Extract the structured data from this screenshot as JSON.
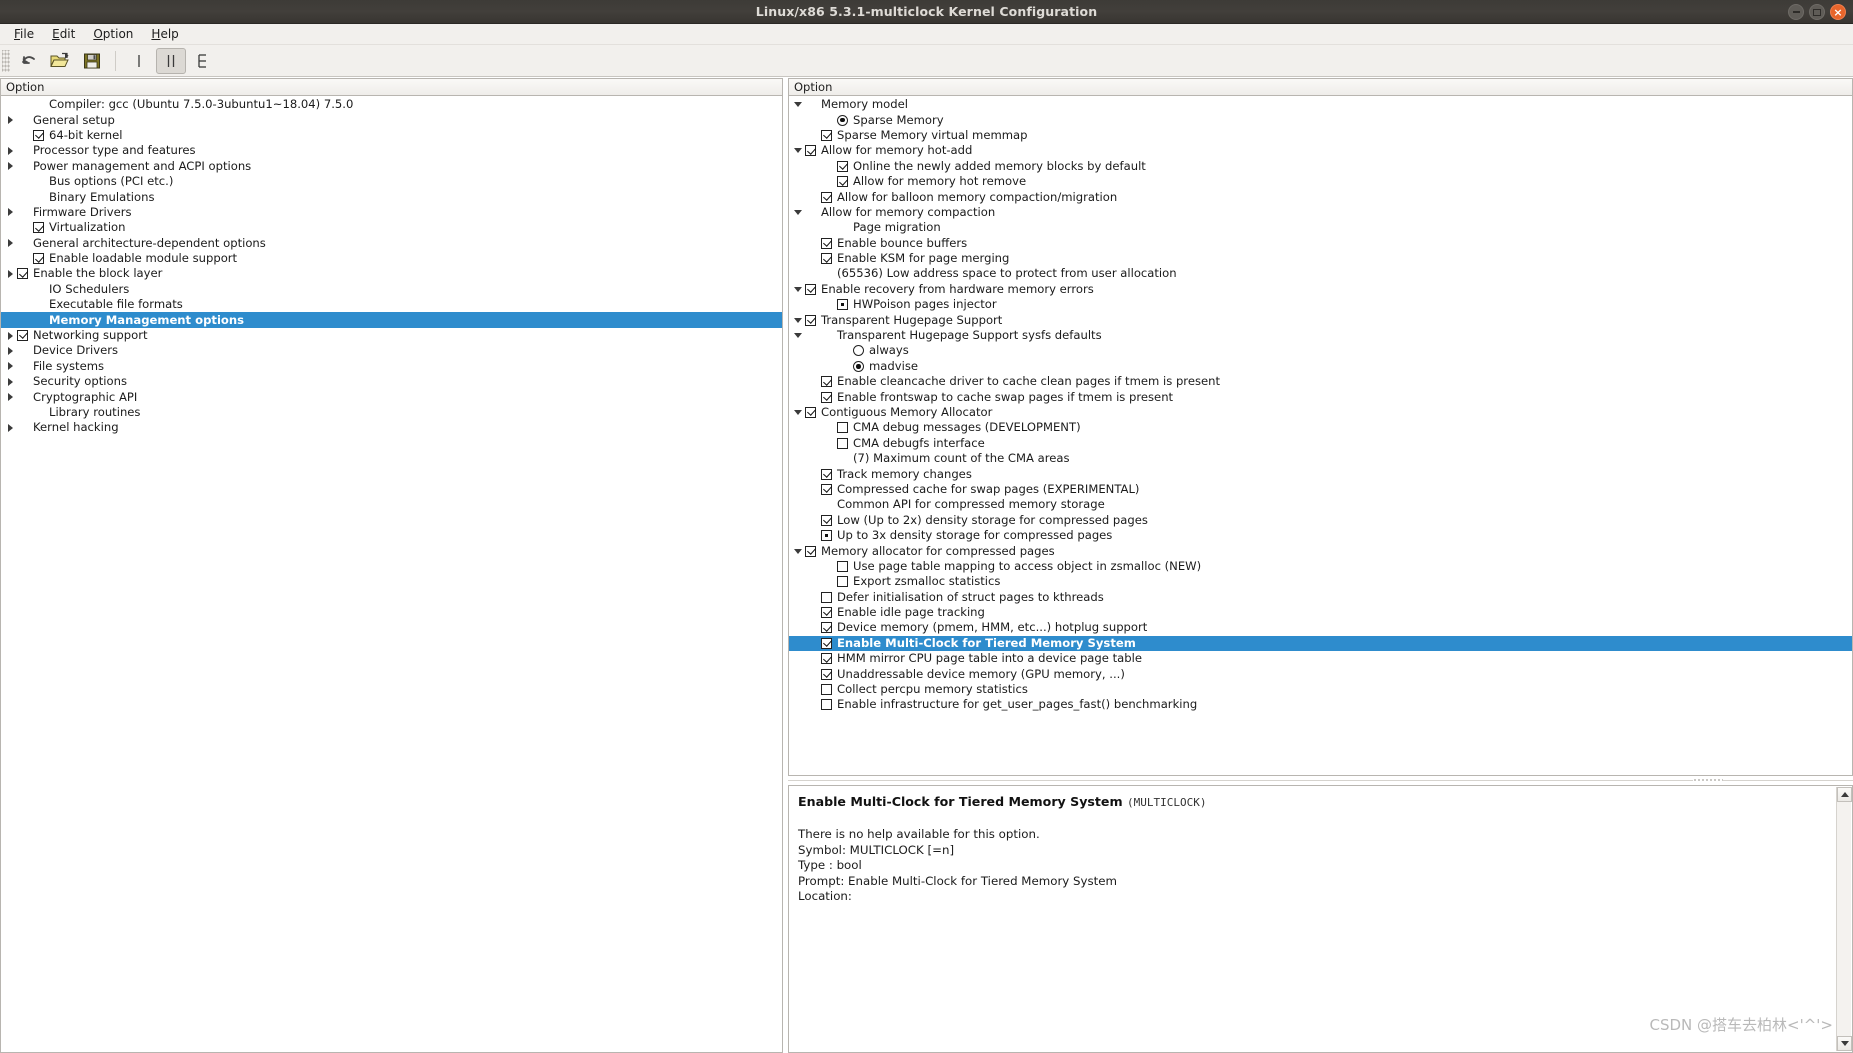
{
  "window": {
    "title": "Linux/x86 5.3.1-multiclock Kernel Configuration",
    "controls": {
      "minimize": "−",
      "maximize": "□",
      "close": "×"
    },
    "accent_selection": "#2e8ccd",
    "titlebar_color": "#403d39",
    "close_color": "#e8652b"
  },
  "menubar": [
    {
      "label": "File",
      "mnemonic": "F"
    },
    {
      "label": "Edit",
      "mnemonic": "E"
    },
    {
      "label": "Option",
      "mnemonic": "O"
    },
    {
      "label": "Help",
      "mnemonic": "H"
    }
  ],
  "toolbar": [
    {
      "name": "back-button",
      "icon": "undo-arrow-icon",
      "active": false
    },
    {
      "name": "load-button",
      "icon": "open-folder-icon",
      "active": false
    },
    {
      "name": "save-button",
      "icon": "floppy-save-icon",
      "active": false
    },
    {
      "name": "single-view-button",
      "icon": "single-pane-icon",
      "active": false
    },
    {
      "name": "split-view-button",
      "icon": "split-pane-icon",
      "active": true
    },
    {
      "name": "full-view-button",
      "icon": "tree-view-icon",
      "active": false
    }
  ],
  "left_panel": {
    "header": "Option",
    "rows": [
      {
        "indent": 1,
        "arrow": "none",
        "box": "none",
        "label": "Compiler: gcc (Ubuntu 7.5.0-3ubuntu1~18.04) 7.5.0"
      },
      {
        "indent": 0,
        "arrow": "right",
        "box": "none",
        "label": "General setup"
      },
      {
        "indent": 1,
        "arrow": "none",
        "box": "checked",
        "label": "64-bit kernel"
      },
      {
        "indent": 0,
        "arrow": "right",
        "box": "none",
        "label": "Processor type and features"
      },
      {
        "indent": 0,
        "arrow": "right",
        "box": "none",
        "label": "Power management and ACPI options"
      },
      {
        "indent": 1,
        "arrow": "none",
        "box": "none",
        "label": "Bus options (PCI etc.)"
      },
      {
        "indent": 1,
        "arrow": "none",
        "box": "none",
        "label": "Binary Emulations"
      },
      {
        "indent": 0,
        "arrow": "right",
        "box": "none",
        "label": "Firmware Drivers"
      },
      {
        "indent": 1,
        "arrow": "none",
        "box": "checked",
        "label": "Virtualization"
      },
      {
        "indent": 0,
        "arrow": "right",
        "box": "none",
        "label": "General architecture-dependent options"
      },
      {
        "indent": 1,
        "arrow": "none",
        "box": "checked",
        "label": "Enable loadable module support"
      },
      {
        "indent": 0,
        "arrow": "right",
        "box": "checked",
        "label": "Enable the block layer"
      },
      {
        "indent": 1,
        "arrow": "none",
        "box": "none",
        "label": "IO Schedulers"
      },
      {
        "indent": 1,
        "arrow": "none",
        "box": "none",
        "label": "Executable file formats"
      },
      {
        "indent": 1,
        "arrow": "none",
        "box": "none",
        "label": "Memory Management options",
        "selected": true
      },
      {
        "indent": 0,
        "arrow": "right",
        "box": "checked",
        "label": "Networking support"
      },
      {
        "indent": 0,
        "arrow": "right",
        "box": "none",
        "label": "Device Drivers"
      },
      {
        "indent": 0,
        "arrow": "right",
        "box": "none",
        "label": "File systems"
      },
      {
        "indent": 0,
        "arrow": "right",
        "box": "none",
        "label": "Security options"
      },
      {
        "indent": 0,
        "arrow": "right",
        "box": "none",
        "label": "Cryptographic API"
      },
      {
        "indent": 1,
        "arrow": "none",
        "box": "none",
        "label": "Library routines"
      },
      {
        "indent": 0,
        "arrow": "right",
        "box": "none",
        "label": "Kernel hacking"
      }
    ]
  },
  "right_panel": {
    "header": "Option",
    "rows": [
      {
        "indent": 0,
        "arrow": "down",
        "box": "none",
        "label": "Memory model"
      },
      {
        "indent": 2,
        "arrow": "none",
        "box": "radio-on",
        "label": "Sparse Memory"
      },
      {
        "indent": 1,
        "arrow": "none",
        "box": "checked",
        "label": "Sparse Memory virtual memmap"
      },
      {
        "indent": 0,
        "arrow": "down",
        "box": "checked",
        "label": "Allow for memory hot-add"
      },
      {
        "indent": 2,
        "arrow": "none",
        "box": "checked",
        "label": "Online the newly added memory blocks by default"
      },
      {
        "indent": 2,
        "arrow": "none",
        "box": "checked",
        "label": "Allow for memory hot remove"
      },
      {
        "indent": 1,
        "arrow": "none",
        "box": "checked",
        "label": "Allow for balloon memory compaction/migration"
      },
      {
        "indent": 0,
        "arrow": "down",
        "box": "none",
        "label": "Allow for memory compaction"
      },
      {
        "indent": 2,
        "arrow": "none",
        "box": "none",
        "label": "Page migration"
      },
      {
        "indent": 1,
        "arrow": "none",
        "box": "checked",
        "label": "Enable bounce buffers"
      },
      {
        "indent": 1,
        "arrow": "none",
        "box": "checked",
        "label": "Enable KSM for page merging"
      },
      {
        "indent": 1,
        "arrow": "none",
        "box": "none",
        "label": "(65536) Low address space to protect from user allocation"
      },
      {
        "indent": 0,
        "arrow": "down",
        "box": "checked",
        "label": "Enable recovery from hardware memory errors"
      },
      {
        "indent": 2,
        "arrow": "none",
        "box": "module",
        "label": "HWPoison pages injector"
      },
      {
        "indent": 0,
        "arrow": "down",
        "box": "checked",
        "label": "Transparent Hugepage Support"
      },
      {
        "indent": 1,
        "arrow": "down",
        "box": "none",
        "label": "Transparent Hugepage Support sysfs defaults"
      },
      {
        "indent": 3,
        "arrow": "none",
        "box": "radio-off",
        "label": "always"
      },
      {
        "indent": 3,
        "arrow": "none",
        "box": "radio-on",
        "label": "madvise"
      },
      {
        "indent": 1,
        "arrow": "none",
        "box": "checked",
        "label": "Enable cleancache driver to cache clean pages if tmem is present"
      },
      {
        "indent": 1,
        "arrow": "none",
        "box": "checked",
        "label": "Enable frontswap to cache swap pages if tmem is present"
      },
      {
        "indent": 0,
        "arrow": "down",
        "box": "checked",
        "label": "Contiguous Memory Allocator"
      },
      {
        "indent": 2,
        "arrow": "none",
        "box": "unchecked",
        "label": "CMA debug messages (DEVELOPMENT)"
      },
      {
        "indent": 2,
        "arrow": "none",
        "box": "unchecked",
        "label": "CMA debugfs interface"
      },
      {
        "indent": 2,
        "arrow": "none",
        "box": "none",
        "label": "(7) Maximum count of the CMA areas"
      },
      {
        "indent": 1,
        "arrow": "none",
        "box": "checked",
        "label": "Track memory changes"
      },
      {
        "indent": 1,
        "arrow": "none",
        "box": "checked",
        "label": "Compressed cache for swap pages (EXPERIMENTAL)"
      },
      {
        "indent": 1,
        "arrow": "none",
        "box": "none",
        "label": "Common API for compressed memory storage"
      },
      {
        "indent": 1,
        "arrow": "none",
        "box": "checked",
        "label": "Low (Up to 2x) density storage for compressed pages"
      },
      {
        "indent": 1,
        "arrow": "none",
        "box": "module",
        "label": "Up to 3x density storage for compressed pages"
      },
      {
        "indent": 0,
        "arrow": "down",
        "box": "checked",
        "label": "Memory allocator for compressed pages"
      },
      {
        "indent": 2,
        "arrow": "none",
        "box": "unchecked",
        "label": "Use page table mapping to access object in zsmalloc (NEW)"
      },
      {
        "indent": 2,
        "arrow": "none",
        "box": "unchecked",
        "label": "Export zsmalloc statistics"
      },
      {
        "indent": 1,
        "arrow": "none",
        "box": "unchecked",
        "label": "Defer initialisation of struct pages to kthreads"
      },
      {
        "indent": 1,
        "arrow": "none",
        "box": "checked",
        "label": "Enable idle page tracking"
      },
      {
        "indent": 1,
        "arrow": "none",
        "box": "checked",
        "label": "Device memory (pmem, HMM, etc...) hotplug support"
      },
      {
        "indent": 1,
        "arrow": "none",
        "box": "checked",
        "label": "Enable Multi-Clock for Tiered Memory System",
        "selected": true
      },
      {
        "indent": 1,
        "arrow": "none",
        "box": "checked",
        "label": "HMM mirror CPU page table into a device page table"
      },
      {
        "indent": 1,
        "arrow": "none",
        "box": "checked",
        "label": "Unaddressable device memory (GPU memory, ...)"
      },
      {
        "indent": 1,
        "arrow": "none",
        "box": "unchecked",
        "label": "Collect percpu memory statistics"
      },
      {
        "indent": 1,
        "arrow": "none",
        "box": "unchecked",
        "label": "Enable infrastructure for get_user_pages_fast() benchmarking"
      }
    ]
  },
  "help": {
    "title": "Enable Multi-Clock for Tiered Memory System",
    "symbol_paren": "(MULTICLOCK)",
    "lines": [
      "There is no help available for this option.",
      "Symbol: MULTICLOCK [=n]",
      "Type : bool",
      "Prompt: Enable Multi-Clock for Tiered Memory System",
      "Location:"
    ]
  },
  "watermark": "CSDN @搭车去柏林<'^'>"
}
